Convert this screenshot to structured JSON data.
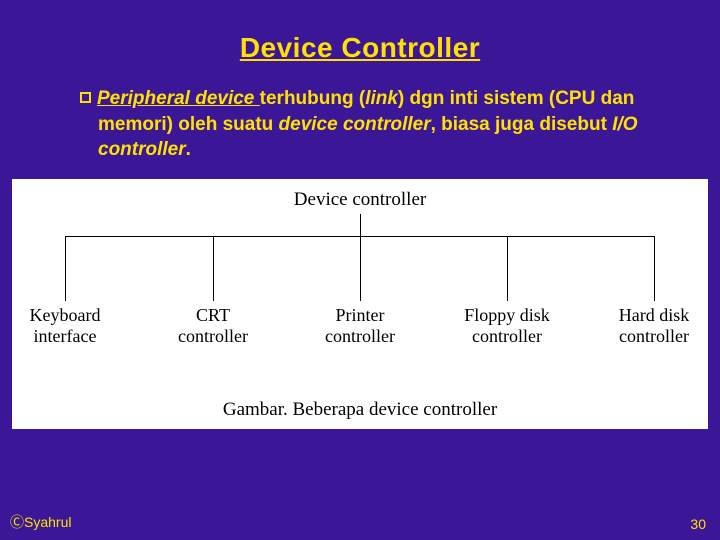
{
  "slide": {
    "title": "Device Controller",
    "bullet": {
      "part1_ital_under": "Peripheral device ",
      "part2_bold": "terhubung (",
      "part3_ital": "link",
      "part4_bold": ") dgn inti sistem (CPU dan memori) oleh suatu ",
      "part5_ital": "device controller",
      "part6_bold": ", biasa juga disebut ",
      "part7_ital": "I/O controller",
      "part8_bold": "."
    },
    "diagram": {
      "root": "Device controller",
      "leaves": [
        {
          "line1": "Keyboard",
          "line2": "interface"
        },
        {
          "line1": "CRT",
          "line2": "controller"
        },
        {
          "line1": "Printer",
          "line2": "controller"
        },
        {
          "line1": "Floppy disk",
          "line2": "controller"
        },
        {
          "line1": "Hard disk",
          "line2": "controller"
        }
      ],
      "caption": "Gambar. Beberapa device controller"
    },
    "footer": {
      "left": "ⒸSyahrul",
      "right": "30"
    }
  },
  "chart_data": {
    "type": "table",
    "title": "Device controller",
    "root": "Device controller",
    "children": [
      "Keyboard interface",
      "CRT controller",
      "Printer controller",
      "Floppy disk controller",
      "Hard disk controller"
    ],
    "caption": "Gambar. Beberapa device controller"
  }
}
